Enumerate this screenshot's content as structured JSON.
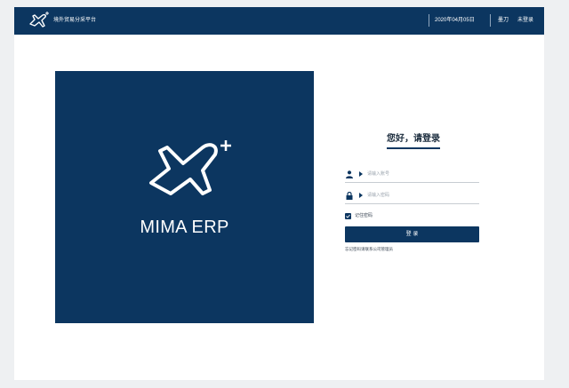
{
  "header": {
    "platform_name": "境外贸易分采平台",
    "date": "2020年04月05日",
    "help_label": "墨刀",
    "login_status": "未登录"
  },
  "hero": {
    "brand_name": "MIMA ERP"
  },
  "login": {
    "title": "您好，请登录",
    "account_placeholder": "请输入账号",
    "password_placeholder": "请输入密码",
    "remember_label": "记住密码",
    "remember_checked": true,
    "submit_label": "登 录",
    "forgot_text": "忘记密码请联系公司管理员"
  },
  "colors": {
    "primary": "#0c3660",
    "background": "#ffffff",
    "page": "#eef0f2"
  },
  "icons": [
    "airplane-plus-logo-icon",
    "user-icon",
    "lock-icon",
    "caret-right-icon",
    "checkmark-icon"
  ]
}
